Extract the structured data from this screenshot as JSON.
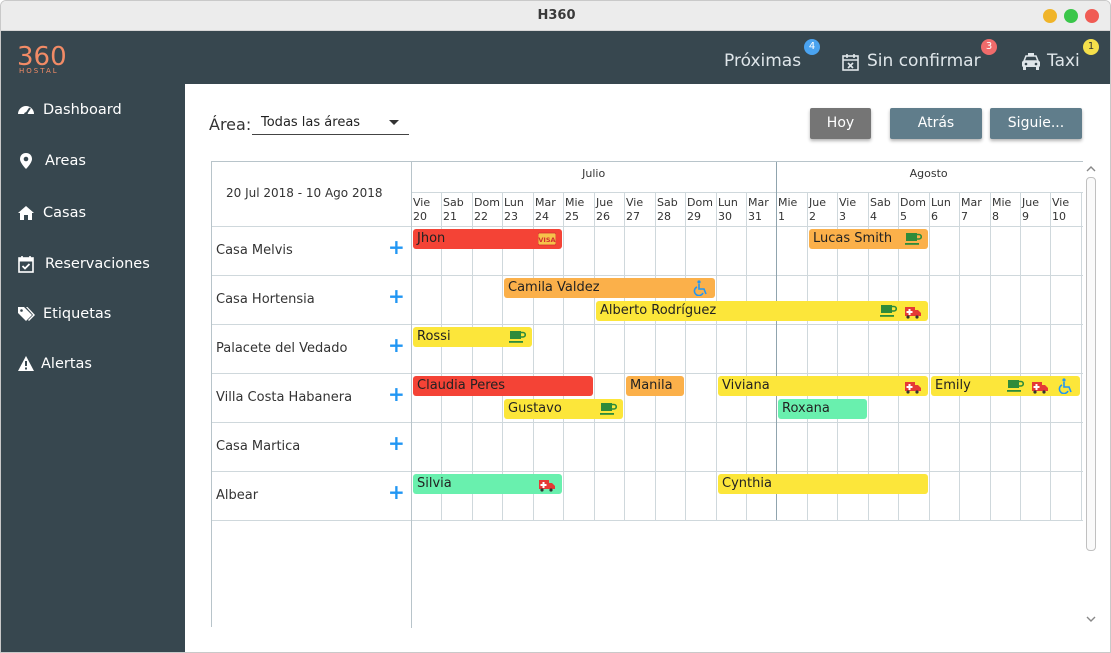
{
  "window": {
    "title": "H360",
    "controls": {
      "minimize_color": "#f0b429",
      "maximize_color": "#3ac64a",
      "close_color": "#f05b54"
    }
  },
  "brand": {
    "logo_number": "360",
    "logo_word": "HOSTAL",
    "logo_color": "#f28b66"
  },
  "topnav": [
    {
      "label": "Próximas",
      "badge": "4",
      "badge_color": "#4aa3f0",
      "icon": ""
    },
    {
      "label": "Sin confirmar",
      "badge": "3",
      "badge_color": "#f06b6b",
      "icon": "calendar-x-icon"
    },
    {
      "label": "Taxi",
      "badge": "1",
      "badge_color": "#f5e04b",
      "icon": "taxi-icon"
    }
  ],
  "sidebar": {
    "items": [
      {
        "label": "Dashboard",
        "icon": "dashboard-icon"
      },
      {
        "label": "Areas",
        "icon": "map-marker-icon"
      },
      {
        "label": "Casas",
        "icon": "home-icon"
      },
      {
        "label": "Reservaciones",
        "icon": "calendar-check-icon"
      },
      {
        "label": "Etiquetas",
        "icon": "tags-icon"
      },
      {
        "label": "Alertas",
        "icon": "warning-icon"
      }
    ]
  },
  "filter": {
    "label": "Área:",
    "selected": "Todas las áreas"
  },
  "buttons": {
    "today": "Hoy",
    "back": "Atrás",
    "next": "Siguie..."
  },
  "calendar": {
    "range_label": "20 Jul 2018 - 10 Ago 2018",
    "months": [
      "Julio",
      "Agosto"
    ],
    "days": [
      {
        "dow": "Vie",
        "d": "20"
      },
      {
        "dow": "Sab",
        "d": "21"
      },
      {
        "dow": "Dom",
        "d": "22"
      },
      {
        "dow": "Lun",
        "d": "23"
      },
      {
        "dow": "Mar",
        "d": "24"
      },
      {
        "dow": "Mie",
        "d": "25"
      },
      {
        "dow": "Jue",
        "d": "26"
      },
      {
        "dow": "Vie",
        "d": "27"
      },
      {
        "dow": "Sab",
        "d": "28"
      },
      {
        "dow": "Dom",
        "d": "29"
      },
      {
        "dow": "Lun",
        "d": "30"
      },
      {
        "dow": "Mar",
        "d": "31"
      },
      {
        "dow": "Mie",
        "d": "1"
      },
      {
        "dow": "Jue",
        "d": "2"
      },
      {
        "dow": "Vie",
        "d": "3"
      },
      {
        "dow": "Sab",
        "d": "4"
      },
      {
        "dow": "Dom",
        "d": "5"
      },
      {
        "dow": "Lun",
        "d": "6"
      },
      {
        "dow": "Mar",
        "d": "7"
      },
      {
        "dow": "Mie",
        "d": "8"
      },
      {
        "dow": "Jue",
        "d": "9"
      },
      {
        "dow": "Vie",
        "d": "10"
      }
    ],
    "rows": [
      {
        "name": "Casa Melvis"
      },
      {
        "name": "Casa Hortensia"
      },
      {
        "name": "Palacete del Vedado"
      },
      {
        "name": "Villa Costa Habanera"
      },
      {
        "name": "Casa Martica"
      },
      {
        "name": "Albear"
      }
    ],
    "reservations": [
      {
        "name": "Jhon",
        "row": 0,
        "lane": 0,
        "start": 0,
        "end": 5,
        "color": "#f44336",
        "icons": [
          "visa-icon"
        ]
      },
      {
        "name": "Lucas Smith",
        "row": 0,
        "lane": 0,
        "start": 13,
        "end": 17,
        "color": "#fbb04a",
        "icons": [
          "coffee-icon"
        ]
      },
      {
        "name": "Camila Valdez",
        "row": 1,
        "lane": 0,
        "start": 3,
        "end": 10,
        "color": "#fbb04a",
        "icons": [
          "wheelchair-icon"
        ]
      },
      {
        "name": "Alberto Rodríguez",
        "row": 1,
        "lane": 1,
        "start": 6,
        "end": 17,
        "color": "#fce63a",
        "icons": [
          "coffee-icon",
          "ambulance-icon"
        ]
      },
      {
        "name": "Rossi",
        "row": 2,
        "lane": 0,
        "start": 0,
        "end": 4,
        "color": "#fce63a",
        "icons": [
          "coffee-icon"
        ]
      },
      {
        "name": "Claudia Peres",
        "row": 3,
        "lane": 0,
        "start": 0,
        "end": 6,
        "color": "#f44336",
        "icons": []
      },
      {
        "name": "Manila",
        "row": 3,
        "lane": 0,
        "start": 7,
        "end": 9,
        "color": "#fbb04a",
        "icons": []
      },
      {
        "name": "Viviana",
        "row": 3,
        "lane": 0,
        "start": 10,
        "end": 17,
        "color": "#fce63a",
        "icons": [
          "ambulance-icon"
        ]
      },
      {
        "name": "Emily",
        "row": 3,
        "lane": 0,
        "start": 17,
        "end": 22,
        "color": "#fce63a",
        "icons": [
          "coffee-icon",
          "ambulance-icon",
          "wheelchair-icon"
        ]
      },
      {
        "name": "Gustavo",
        "row": 3,
        "lane": 1,
        "start": 3,
        "end": 7,
        "color": "#fce63a",
        "icons": [
          "coffee-icon"
        ]
      },
      {
        "name": "Roxana",
        "row": 3,
        "lane": 1,
        "start": 12,
        "end": 15,
        "color": "#69f0ae",
        "icons": []
      },
      {
        "name": "Silvia",
        "row": 5,
        "lane": 0,
        "start": 0,
        "end": 5,
        "color": "#69f0ae",
        "icons": [
          "ambulance-icon"
        ]
      },
      {
        "name": "Cynthia",
        "row": 5,
        "lane": 0,
        "start": 10,
        "end": 17,
        "color": "#fce63a",
        "icons": []
      }
    ]
  },
  "colors": {
    "sidebar": "#37474f",
    "add_button": "#2196f3",
    "today_button": "#757575",
    "nav_button": "#607d8b"
  }
}
